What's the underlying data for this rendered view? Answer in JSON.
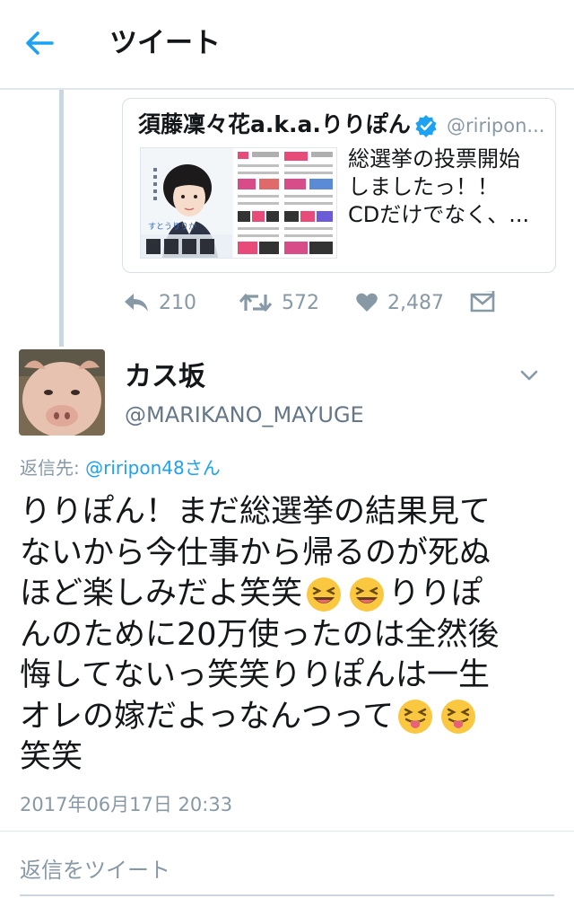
{
  "header": {
    "title": "ツイート",
    "back_icon": "arrow-left-icon",
    "accent": "#1da1f2"
  },
  "quoted_tweet": {
    "author_name": "須藤凜々花a.k.a.りりぽん",
    "author_handle": "@riripon...",
    "verified": true,
    "text_lines": [
      "総選挙の投票開始",
      "しましたっ！！",
      "CDだけでなく、..."
    ],
    "media_caption": "すとうりりか"
  },
  "actions": {
    "reply_count": "210",
    "retweet_count": "572",
    "like_count": "2,487"
  },
  "tweet": {
    "author_name": "カス坂",
    "author_handle": "@MARIKANO_MAYUGE",
    "reply_to_label": "返信先: ",
    "reply_to_mention": "@riripon48さん",
    "lines": {
      "l1": "りりぽん！まだ総選挙の結果見て",
      "l2": "ないから今仕事から帰るのが死ぬ",
      "l3": "ほど楽しみだよ笑笑",
      "l3b": "りりぽ",
      "l4": "んのために20万使ったのは全然後",
      "l5": "悔してないっ笑笑りりぽんは一生",
      "l6": "オレの嫁だよっなんつって",
      "l7": "笑笑"
    },
    "timestamp": "2017年06月17日 20:33"
  },
  "reply_box": {
    "placeholder": "返信をツイート"
  },
  "colors": {
    "muted": "#8899a6",
    "link": "#1da1f2",
    "emoji": "#f9c740"
  }
}
